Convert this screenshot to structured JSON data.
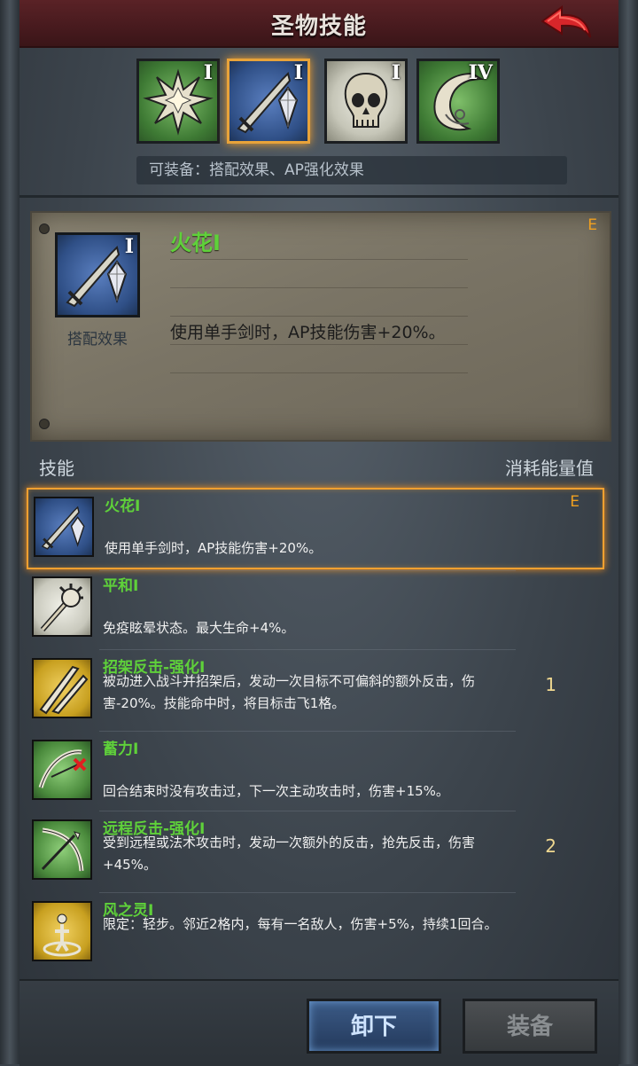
{
  "header": {
    "title": "圣物技能",
    "back_icon": "red-back-arrow-icon"
  },
  "relic_tabs": [
    {
      "icon": "spark-burst-icon",
      "rank": "I",
      "color": "#4a8a3c",
      "selected": false
    },
    {
      "icon": "sword-crystal-icon",
      "rank": "I",
      "color": "#2f4f86",
      "selected": true
    },
    {
      "icon": "skull-icon",
      "rank": "I",
      "color": "#d0d0c0",
      "selected": false
    },
    {
      "icon": "crescent-swirl-icon",
      "rank": "IV",
      "color": "#4a8a3c",
      "selected": false
    }
  ],
  "equip_note": "可装备：搭配效果、AP强化效果",
  "detail": {
    "rank": "I",
    "icon_label": "搭配效果",
    "name": "火花I",
    "energy": "E",
    "desc": "使用单手剑时，AP技能伤害+20%。"
  },
  "list_header": {
    "left": "技能",
    "right": "消耗能量值"
  },
  "skills": [
    {
      "name": "火花I",
      "desc": "使用单手剑时，AP技能伤害+20%。",
      "energy": "E",
      "icon": "sword-crystal-icon",
      "color": "#2f4f86"
    },
    {
      "name": "平和I",
      "desc": "免疫眩晕状态。最大生命+4%。",
      "energy": "",
      "icon": "morningstar-icon",
      "color": "#d8d8d0"
    },
    {
      "name": "招架反击-强化I",
      "desc": "被动进入战斗并招架后，发动一次目标不可偏斜的额外反击，伤害-20%。技能命中时，将目标击飞1格。",
      "energy": "1",
      "icon": "crossed-blades-icon",
      "color": "#c8a020"
    },
    {
      "name": "蓄力I",
      "desc": "回合结束时没有攻击过，下一次主动攻击时，伤害+15%。",
      "energy": "",
      "icon": "bow-charge-icon",
      "color": "#4a8a3c"
    },
    {
      "name": "远程反击-强化I",
      "desc": "受到远程或法术攻击时，发动一次额外的反击，抢先反击，伤害+45%。",
      "energy": "2",
      "icon": "bow-arrow-icon",
      "color": "#4a8a3c"
    },
    {
      "name": "风之灵I",
      "desc": "限定：轻步。邻近2格内，每有一名敌人，伤害+5%，持续1回合。",
      "energy": "",
      "icon": "wind-spirit-icon",
      "color": "#c8a020"
    }
  ],
  "buttons": {
    "unequip": "卸下",
    "equip": "装备"
  }
}
